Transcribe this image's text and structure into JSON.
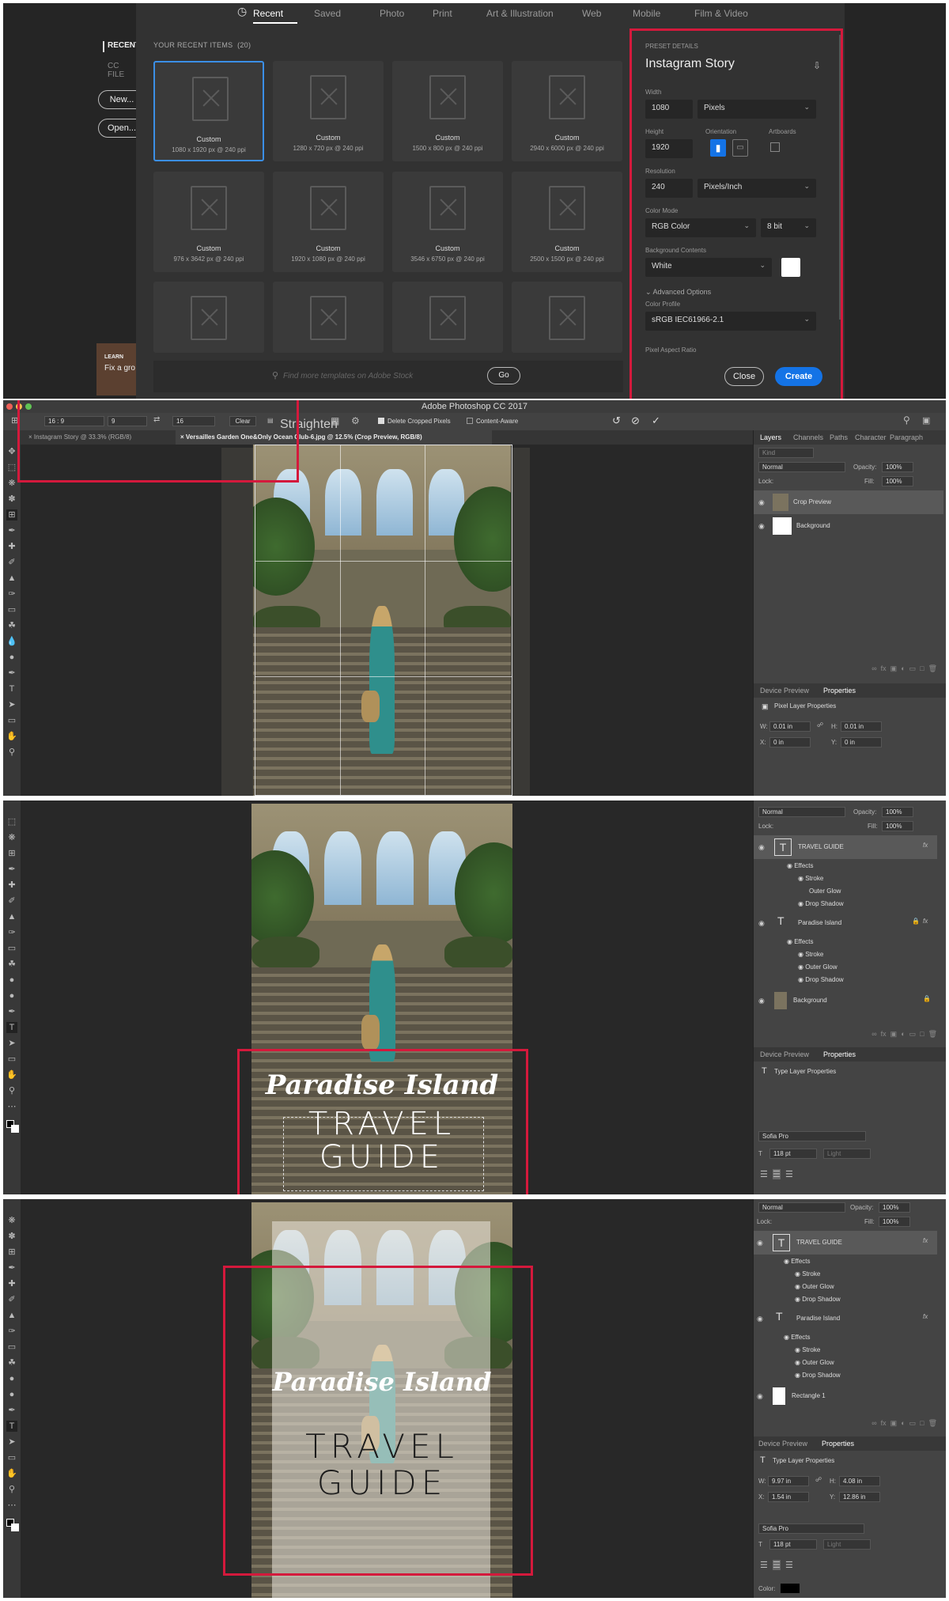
{
  "new_doc_dialog": {
    "tabs": [
      "Recent",
      "Saved",
      "Photo",
      "Print",
      "Art & Illustration",
      "Web",
      "Mobile",
      "Film & Video"
    ],
    "sidebar": {
      "recent_label": "RECENT",
      "cc_files_label": "CC FILE",
      "new_button": "New...",
      "open_button": "Open...",
      "learn_label": "LEARN",
      "learn_text": "Fix a gro"
    },
    "recent_header": "YOUR RECENT ITEMS",
    "recent_count": "(20)",
    "tiles": [
      {
        "name": "Custom",
        "size": "1080 x 1920 px @ 240 ppi"
      },
      {
        "name": "Custom",
        "size": "1280 x 720 px @ 240 ppi"
      },
      {
        "name": "Custom",
        "size": "1500 x 800 px @ 240 ppi"
      },
      {
        "name": "Custom",
        "size": "2940 x 6000 px @ 240 ppi"
      },
      {
        "name": "Custom",
        "size": "976 x 3642 px @ 240 ppi"
      },
      {
        "name": "Custom",
        "size": "1920 x 1080 px @ 240 ppi"
      },
      {
        "name": "Custom",
        "size": "3546 x 6750 px @ 240 ppi"
      },
      {
        "name": "Custom",
        "size": "2500 x 1500 px @ 240 ppi"
      }
    ],
    "search_placeholder": "Find more templates on Adobe Stock",
    "go_button": "Go",
    "preset": {
      "header": "PRESET DETAILS",
      "name": "Instagram Story",
      "width_label": "Width",
      "width": "1080",
      "width_unit": "Pixels",
      "height_label": "Height",
      "height": "1920",
      "orientation_label": "Orientation",
      "artboards_label": "Artboards",
      "resolution_label": "Resolution",
      "resolution": "240",
      "resolution_unit": "Pixels/Inch",
      "color_mode_label": "Color Mode",
      "color_mode": "RGB Color",
      "bit_depth": "8 bit",
      "bg_label": "Background Contents",
      "bg_value": "White",
      "advanced": "Advanced Options",
      "profile_label": "Color Profile",
      "profile": "sRGB IEC61966-2.1",
      "aspect_label": "Pixel Aspect Ratio",
      "close_button": "Close",
      "create_button": "Create"
    }
  },
  "crop_screen": {
    "app_title": "Adobe Photoshop CC 2017",
    "ratio": "16 : 9",
    "ratio_w": "9",
    "ratio_h": "16",
    "clear": "Clear",
    "straighten": "Straighten",
    "delete_cropped": "Delete Cropped Pixels",
    "content_aware": "Content-Aware",
    "doc_tab_1": "Instagram Story @ 33.3% (RGB/8)",
    "doc_tab_2": "Versailles Garden One&Only Ocean Club-6.jpg @ 12.5% (Crop Preview, RGB/8)",
    "layer_tabs": [
      "Layers",
      "Channels",
      "Paths",
      "Character",
      "Paragraph"
    ],
    "kind": "Kind",
    "blend": "Normal",
    "opacity_label": "Opacity:",
    "opacity": "100%",
    "lock_label": "Lock:",
    "fill_label": "Fill:",
    "fill": "100%",
    "layers": [
      "Crop Preview",
      "Background"
    ],
    "prop_tabs": [
      "Device Preview",
      "Properties"
    ],
    "prop_title": "Pixel Layer Properties",
    "w": "0.01 in",
    "h": "0.01 in",
    "x": "0 in",
    "y": "0 in"
  },
  "type_screen": {
    "blend": "Normal",
    "opacity": "100%",
    "fill": "100%",
    "layers": [
      "TRAVEL GUIDE",
      "Effects",
      "Stroke",
      "Outer Glow",
      "Drop Shadow",
      "Paradise Island",
      "Effects",
      "Stroke",
      "Outer Glow",
      "Drop Shadow",
      "Background"
    ],
    "prop_tabs": [
      "Device Preview",
      "Properties"
    ],
    "prop_title": "Type Layer Properties",
    "font": "Sofia Pro",
    "size": "118 pt",
    "weight": "Light",
    "overlay_script": "Paradise Island",
    "overlay_line1": "TRAVEL",
    "overlay_line2": "GUIDE"
  },
  "rect_screen": {
    "blend": "Normal",
    "opacity": "100%",
    "fill": "100%",
    "layers": [
      "TRAVEL GUIDE",
      "Effects",
      "Stroke",
      "Outer Glow",
      "Drop Shadow",
      "Paradise Island",
      "Effects",
      "Stroke",
      "Outer Glow",
      "Drop Shadow",
      "Rectangle 1"
    ],
    "prop_tabs": [
      "Device Preview",
      "Properties"
    ],
    "prop_title": "Type Layer Properties",
    "w": "9.97 in",
    "h": "4.08 in",
    "x": "1.54 in",
    "y": "12.86 in",
    "font": "Sofia Pro",
    "size": "118 pt",
    "weight": "Light",
    "color_label": "Color:",
    "overlay_script": "Paradise Island",
    "overlay_line1": "TRAVEL",
    "overlay_line2": "GUIDE"
  },
  "colors": {
    "highlight": "#d4193c",
    "accent": "#1473e6"
  }
}
